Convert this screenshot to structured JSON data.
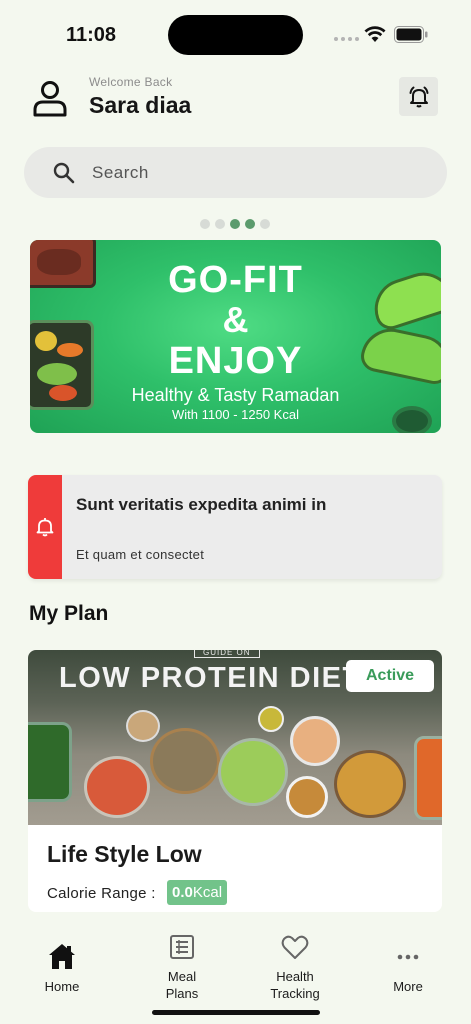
{
  "status_bar": {
    "time": "11:08"
  },
  "header": {
    "welcome": "Welcome Back",
    "user_name": "Sara diaa"
  },
  "search": {
    "placeholder": "Search"
  },
  "carousel": {
    "pages": 5,
    "active_index": 2,
    "banner": {
      "line1": "GO-FIT",
      "line2": "&",
      "line3": "ENJOY",
      "line4": "Healthy & Tasty Ramadan",
      "line5": "With 1100 - 1250 Kcal"
    }
  },
  "alert": {
    "title": "Sunt veritatis expedita animi in",
    "body": "Et quam et consectet",
    "accent_color": "#ef3b3a"
  },
  "my_plan": {
    "section_title": "My Plan",
    "guide_label": "GUIDE ON",
    "image_headline": "LOW PROTEIN DIET F",
    "status": "Active",
    "plan_name": "Life Style Low",
    "calorie_label": "Calorie Range :",
    "calorie_value": "0.0",
    "calorie_unit": "Kcal"
  },
  "nav": {
    "items": [
      {
        "label": "Home",
        "icon": "home-icon"
      },
      {
        "label": "Meal\nPlans",
        "icon": "meal-plans-icon"
      },
      {
        "label": "Health\nTracking",
        "icon": "heart-icon"
      },
      {
        "label": "More",
        "icon": "more-icon"
      }
    ]
  },
  "colors": {
    "background": "#f4f8ef",
    "accent_green": "#3a9b5a",
    "calorie_badge": "#72c38a",
    "alert_red": "#ef3b3a"
  }
}
